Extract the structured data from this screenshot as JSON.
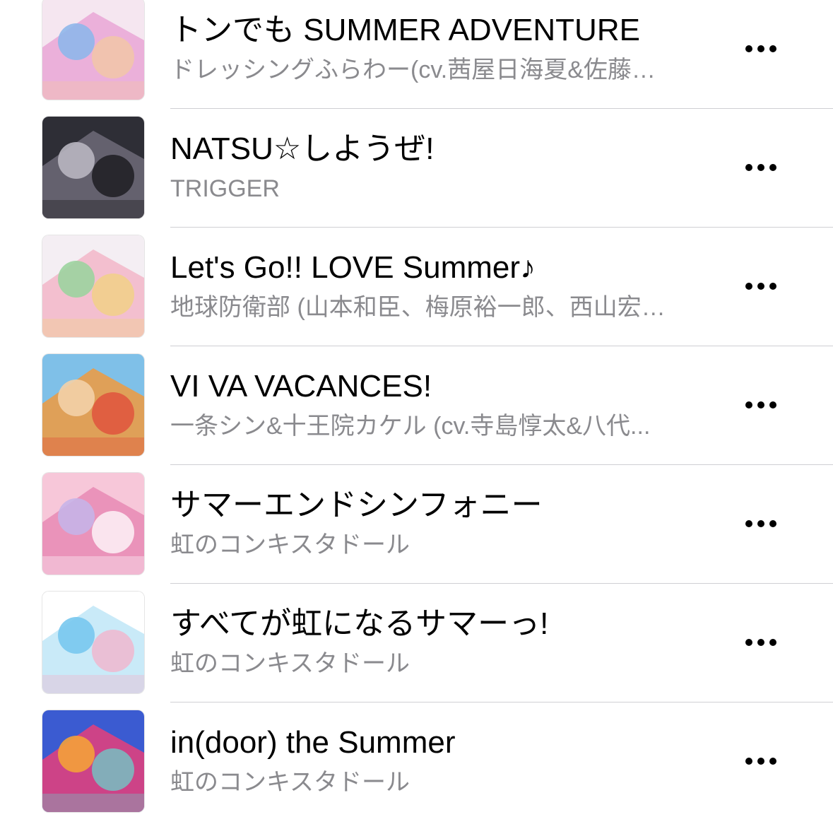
{
  "songs": [
    {
      "title": "トンでも SUMMER ADVENTURE",
      "artist": "ドレッシングふらわー(cv.茜屋日海夏&佐藤…",
      "art_colors": [
        "#f5e6f0",
        "#e9a6d6",
        "#8fb7ea",
        "#f3c9a0"
      ]
    },
    {
      "title": "NATSU☆しようぜ!",
      "artist": "TRIGGER",
      "art_colors": [
        "#2e2e36",
        "#6d6a78",
        "#b8b6c0",
        "#141418"
      ]
    },
    {
      "title": "Let's Go!! LOVE Summer♪",
      "artist": "地球防衛部 (山本和臣、梅原裕一郎、西山宏…",
      "art_colors": [
        "#f4eef3",
        "#f2b6c8",
        "#9cd39e",
        "#f1d37e"
      ]
    },
    {
      "title": "VI VA VACANCES!",
      "artist": "一条シン&十王院カケル (cv.寺島惇太&八代...",
      "art_colors": [
        "#7fc0e8",
        "#f09a3e",
        "#f3d0a8",
        "#e04a3a"
      ]
    },
    {
      "title": "サマーエンドシンフォニー",
      "artist": "虹のコンキスタドール",
      "art_colors": [
        "#f7c7d9",
        "#e889b4",
        "#c6b4e8",
        "#ffffff"
      ]
    },
    {
      "title": "すべてが虹になるサマーっ!",
      "artist": "虹のコンキスタドール",
      "art_colors": [
        "#ffffff",
        "#bfe6f7",
        "#78c8ee",
        "#f4b0c9"
      ]
    },
    {
      "title": "in(door) the Summer",
      "artist": "虹のコンキスタドール",
      "art_colors": [
        "#3b5bd1",
        "#e8407a",
        "#f4a13a",
        "#6ad0c9"
      ]
    }
  ],
  "icons": {
    "more": "ellipsis-icon",
    "art": "album-art-icon"
  },
  "colors": {
    "title": "#000000",
    "subtitle": "#8a8a8e",
    "separator": "#cfcfd3"
  }
}
